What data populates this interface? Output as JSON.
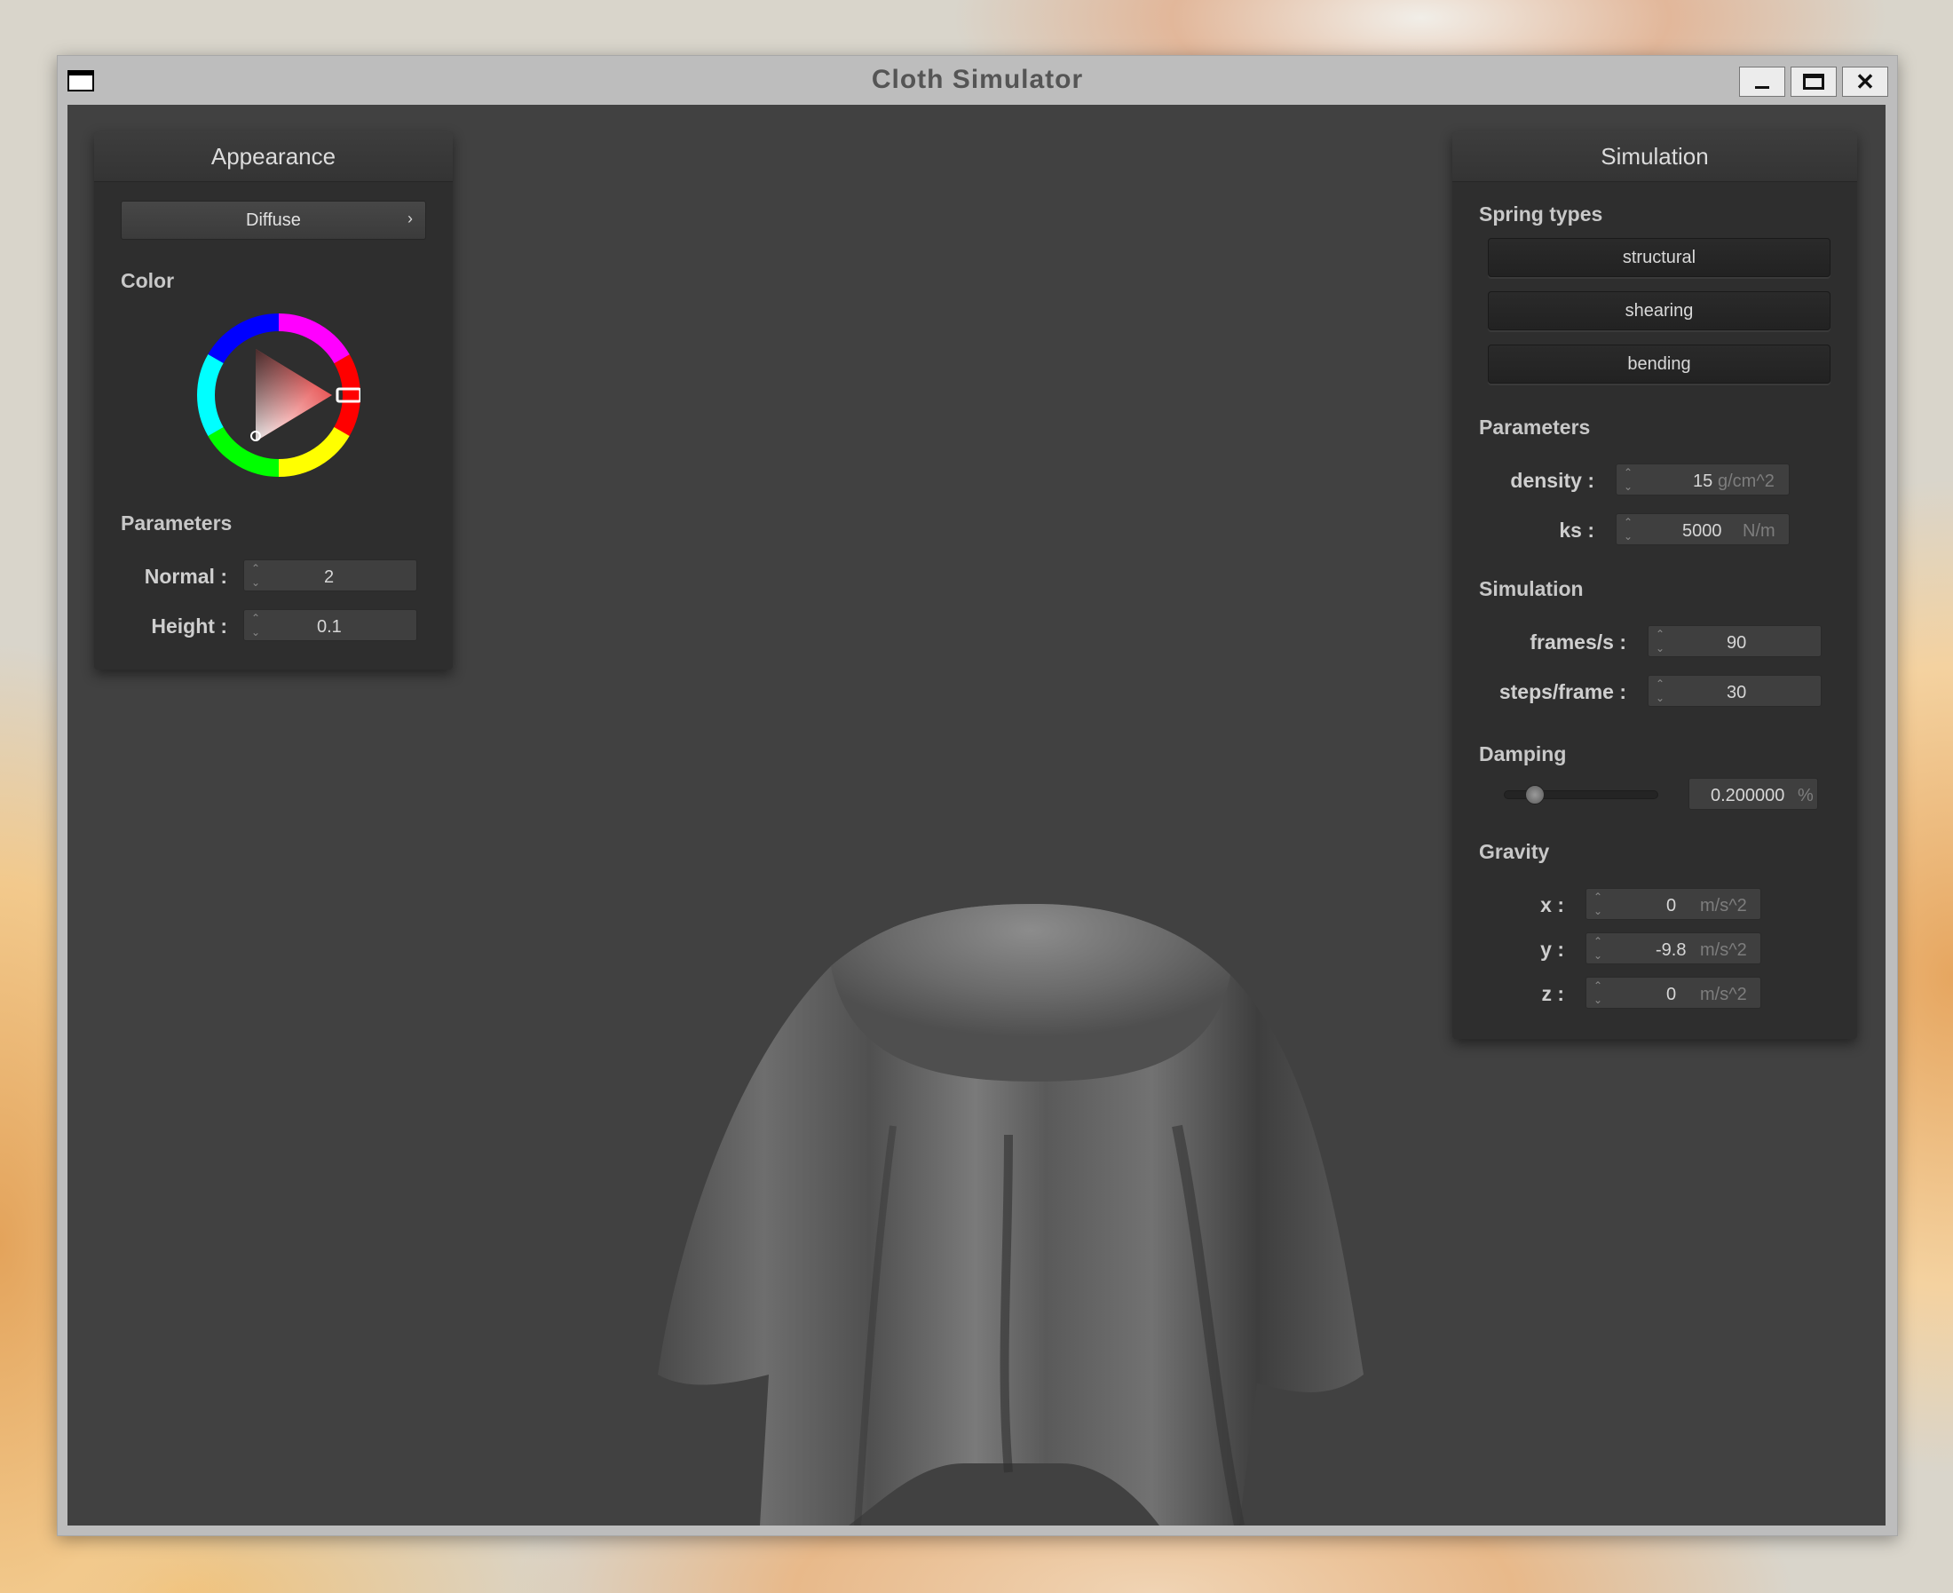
{
  "window": {
    "title": "Cloth Simulator",
    "controls": {
      "minimize": "minimize",
      "maximize": "maximize",
      "close": "✕"
    }
  },
  "appearance": {
    "header": "Appearance",
    "shader_select": "Diffuse",
    "color_label": "Color",
    "selected_color": "#e02222",
    "parameters_label": "Parameters",
    "normal": {
      "label": "Normal :",
      "value": "2"
    },
    "height": {
      "label": "Height :",
      "value": "0.1"
    }
  },
  "simulation": {
    "header": "Simulation",
    "spring_types_label": "Spring types",
    "spring_types": [
      "structural",
      "shearing",
      "bending"
    ],
    "parameters_label": "Parameters",
    "density": {
      "label": "density :",
      "value": "15",
      "unit": "g/cm^2"
    },
    "ks": {
      "label": "ks :",
      "value": "5000",
      "unit": "N/m"
    },
    "simulation_label": "Simulation",
    "fps": {
      "label": "frames/s :",
      "value": "90"
    },
    "steps": {
      "label": "steps/frame :",
      "value": "30"
    },
    "damping_label": "Damping",
    "damping": {
      "value": "0.200000",
      "unit": "%",
      "fraction": 0.2
    },
    "gravity_label": "Gravity",
    "gravity_x": {
      "label": "x :",
      "value": "0",
      "unit": "m/s^2"
    },
    "gravity_y": {
      "label": "y :",
      "value": "-9.8",
      "unit": "m/s^2"
    },
    "gravity_z": {
      "label": "z :",
      "value": "0",
      "unit": "m/s^2"
    }
  },
  "icons": {
    "app": "window-icon",
    "spinner": "spinner-icon",
    "dropdown": "chevron-right-icon"
  }
}
